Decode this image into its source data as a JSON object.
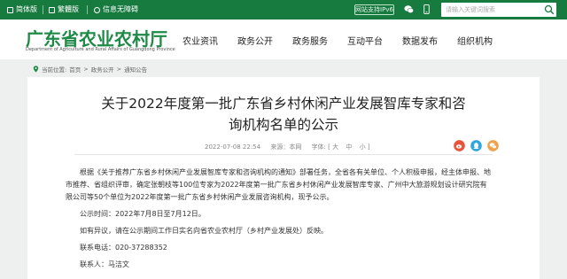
{
  "topbar": {
    "version_label": "简体版",
    "traditional_label": "繁體版",
    "accessibility_label": "信息无障碍",
    "ipv6_label": "网站支持IPv6",
    "search_placeholder": "请输入关键词搜索"
  },
  "header": {
    "logo_cn": "广东省农业农村厅",
    "logo_en": "Department of Agriculture and Rural Affairs of Guangdong Province",
    "nav": [
      "农业资讯",
      "政务公开",
      "政务服务",
      "互动平台",
      "数据发布",
      "组织机构"
    ]
  },
  "breadcrumb": {
    "prefix": "当前位置:",
    "items": [
      "首页",
      "政务公开",
      "通知公告"
    ],
    "separator": ">"
  },
  "article": {
    "title": "关于2022年度第一批广东省乡村休闲产业发展智库专家和咨询机构名单的公示",
    "date": "2022-07-08 22:54",
    "source": "来源：本网",
    "font_label": "字体:",
    "font_sizes": [
      "大",
      "中",
      "小"
    ],
    "paragraphs": {
      "p1_line1": "根据《关于推荐广东省乡村休闲产业发展智库专家和咨询机构的通知》部署任务，全省各有关单位、个人积极申报，经主体申报、地",
      "p1_line2": "市推荐、省组织评审，确定张朝枝等100位专家为2022年度第一批广东省乡村休闲产业发展智库专家、广州中大旅游规划设计研究院有",
      "p1_line3": "限公司等50个单位为2022年度第一批广东省乡村休闲产业发展咨询机构，现予公示。",
      "p2": "公示时间：2022年7月8日至7月12日。",
      "p3": "如有异议，请在公示期间工作日实名向省农业农村厅（乡村产业发展处）反映。",
      "p4": "联系电话：020-37288352",
      "p5": "联系人：马洁文"
    }
  },
  "colors": {
    "brand_green": "#177a3f",
    "logo_green": "#1e8a46",
    "share_weibo": "#e8543a",
    "share_qq": "#2ea7e0",
    "share_wechat": "#f0a24a"
  }
}
